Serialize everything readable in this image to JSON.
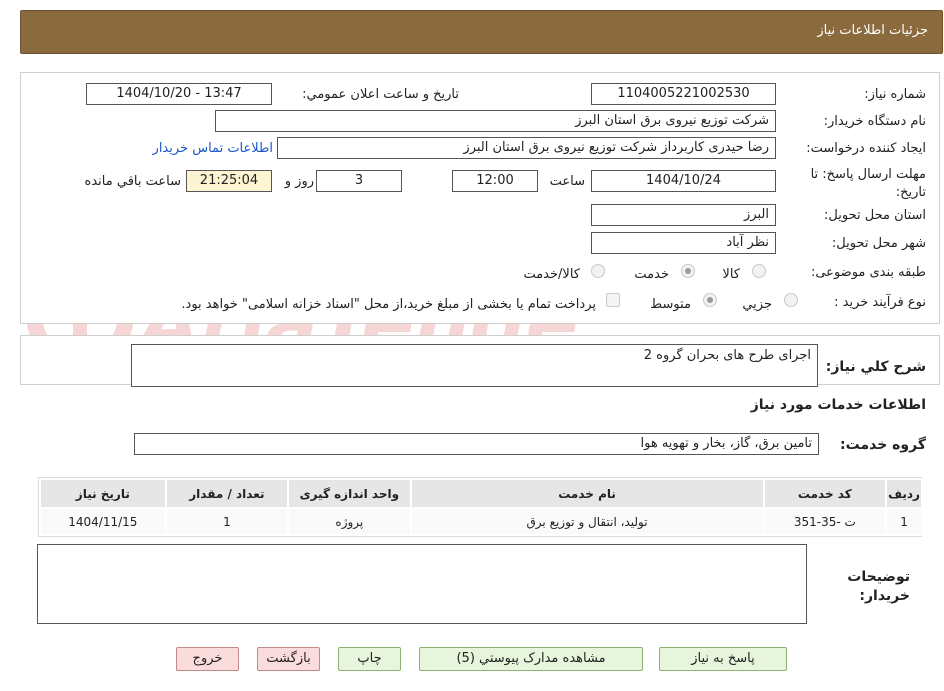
{
  "header": {
    "title": "جزئیات اطلاعات نیاز"
  },
  "form": {
    "need_number_label": "شماره نیاز:",
    "need_number": "1104005221002530",
    "announce_label": "تاریخ و ساعت اعلان عمومي:",
    "announce_value": "1404/10/20 - 13:47",
    "buyer_org_label": "نام دستگاه خريدار:",
    "buyer_org": "شرکت توزیع نیروی برق استان البرز",
    "requester_label": "ايجاد کننده درخواست:",
    "requester": "رضا حیدری کاربرداز شرکت توزیع نیروی برق استان البرز",
    "contact_link": "اطلاعات تماس خريدار",
    "deadline_label": "مهلت ارسال پاسخ: تا تاريخ:",
    "deadline_date": "1404/10/24",
    "hour_label": "ساعت",
    "deadline_hour": "12:00",
    "days_value": "3",
    "days_label": "روز و",
    "remaining_time": "21:25:04",
    "remaining_label": "ساعت باقي مانده",
    "province_label": "استان محل تحويل:",
    "province": "البرز",
    "city_label": "شهر محل تحويل:",
    "city": "نظر آباد",
    "category_label": "طبقه بندی موضوعی:",
    "category_options": [
      "کالا",
      "خدمت",
      "کالا/خدمت"
    ],
    "category_selected": "خدمت",
    "process_label": "نوع فرآیند خرید :",
    "process_options": [
      "جزيي",
      "متوسط"
    ],
    "process_selected": "متوسط",
    "payment_note": "پرداخت تمام یا بخشی از مبلغ خرید،از محل \"اسناد خزانه اسلامی\" خواهد بود."
  },
  "description": {
    "label": "شرح کلي نياز:",
    "value": "اجرای طرح های بحران گروه 2"
  },
  "services": {
    "section_title": "اطلاعات خدمات مورد نياز",
    "group_label": "گروه خدمت:",
    "group_value": "تامین برق، گاز، بخار و تهویه هوا",
    "columns": [
      "رديف",
      "کد خدمت",
      "نام خدمت",
      "واحد اندازه گيری",
      "تعداد / مقدار",
      "تاريخ نياز"
    ],
    "rows": [
      {
        "row": "1",
        "code": "ت -35-351",
        "name": "تولید، انتقال و توزیع برق",
        "unit": "پروژه",
        "qty": "1",
        "date": "1404/11/15"
      }
    ]
  },
  "buyer_notes": {
    "label": "توضيحات خريدار:",
    "value": ""
  },
  "buttons": {
    "reply": "پاسخ به نياز",
    "attachments": "مشاهده مدارک پيوستي (5)",
    "print": "چاپ",
    "back": "بازگشت",
    "exit": "خروج"
  },
  "watermark": {
    "text": "AriaTender.neT"
  },
  "colors": {
    "header_bg": "#8b6a3e",
    "link": "#1a57c9",
    "remaining_bg": "#fdf5d2"
  }
}
